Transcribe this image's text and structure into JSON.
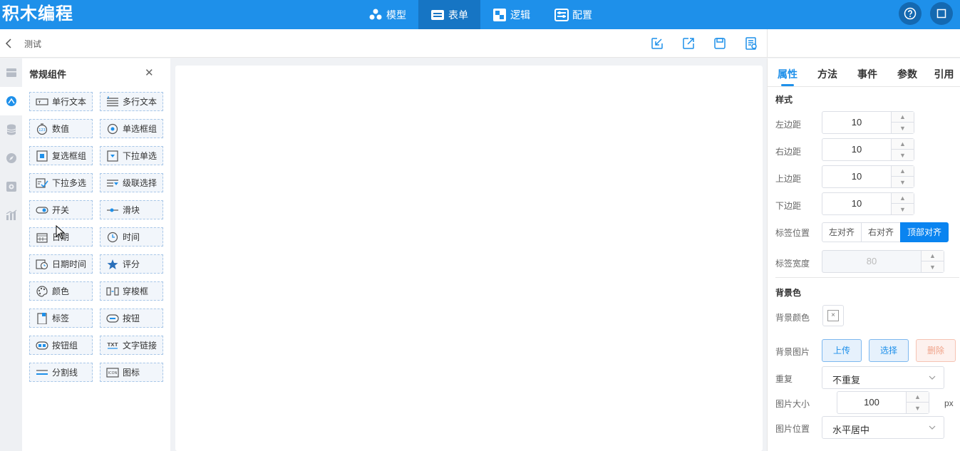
{
  "app": {
    "logo": "积木编程"
  },
  "topnav": [
    {
      "label": "模型",
      "icon": "model-icon",
      "active": false
    },
    {
      "label": "表单",
      "icon": "form-icon",
      "active": true
    },
    {
      "label": "逻辑",
      "icon": "logic-icon",
      "active": false
    },
    {
      "label": "配置",
      "icon": "config-icon",
      "active": false
    }
  ],
  "subbar": {
    "page_name": "测试"
  },
  "component_panel": {
    "title": "常规组件",
    "items": [
      {
        "label": "单行文本",
        "icon": "single-line-text-icon"
      },
      {
        "label": "多行文本",
        "icon": "multi-line-text-icon"
      },
      {
        "label": "数值",
        "icon": "number-icon"
      },
      {
        "label": "单选框组",
        "icon": "radio-group-icon"
      },
      {
        "label": "复选框组",
        "icon": "checkbox-group-icon"
      },
      {
        "label": "下拉单选",
        "icon": "dropdown-single-icon"
      },
      {
        "label": "下拉多选",
        "icon": "dropdown-multi-icon"
      },
      {
        "label": "级联选择",
        "icon": "cascader-icon"
      },
      {
        "label": "开关",
        "icon": "switch-icon"
      },
      {
        "label": "滑块",
        "icon": "slider-icon"
      },
      {
        "label": "日期",
        "icon": "date-icon"
      },
      {
        "label": "时间",
        "icon": "time-icon"
      },
      {
        "label": "日期时间",
        "icon": "datetime-icon"
      },
      {
        "label": "评分",
        "icon": "rating-icon"
      },
      {
        "label": "颜色",
        "icon": "color-icon"
      },
      {
        "label": "穿梭框",
        "icon": "transfer-icon"
      },
      {
        "label": "标签",
        "icon": "tag-icon"
      },
      {
        "label": "按钮",
        "icon": "button-icon"
      },
      {
        "label": "按钮组",
        "icon": "button-group-icon"
      },
      {
        "label": "文字链接",
        "icon": "text-link-icon"
      },
      {
        "label": "分割线",
        "icon": "divider-icon"
      },
      {
        "label": "图标",
        "icon": "icon-icon"
      }
    ]
  },
  "right_panel": {
    "tabs": [
      "属性",
      "方法",
      "事件",
      "参数",
      "引用"
    ],
    "style_section": "样式",
    "margin_left": {
      "label": "左边距",
      "value": "10"
    },
    "margin_right": {
      "label": "右边距",
      "value": "10"
    },
    "margin_top": {
      "label": "上边距",
      "value": "10"
    },
    "margin_bottom": {
      "label": "下边距",
      "value": "10"
    },
    "label_position": {
      "label": "标签位置",
      "options": [
        "左对齐",
        "右对齐",
        "顶部对齐"
      ],
      "selected": "顶部对齐"
    },
    "label_width": {
      "label": "标签宽度",
      "value": "80"
    },
    "bg_section": "背景色",
    "bg_color": {
      "label": "背景颜色",
      "clear_glyph": "×"
    },
    "bg_image": {
      "label": "背景图片",
      "upload": "上传",
      "select": "选择",
      "delete": "删除"
    },
    "repeat": {
      "label": "重复",
      "value": "不重复"
    },
    "image_size": {
      "label": "图片大小",
      "value": "100",
      "unit": "px"
    },
    "image_position": {
      "label": "图片位置",
      "value": "水平居中"
    }
  },
  "colors": {
    "primary": "#1e90ea",
    "topbar": "#1e90ea",
    "active_nav": "#1675c4",
    "danger_text": "#f0a38a"
  }
}
